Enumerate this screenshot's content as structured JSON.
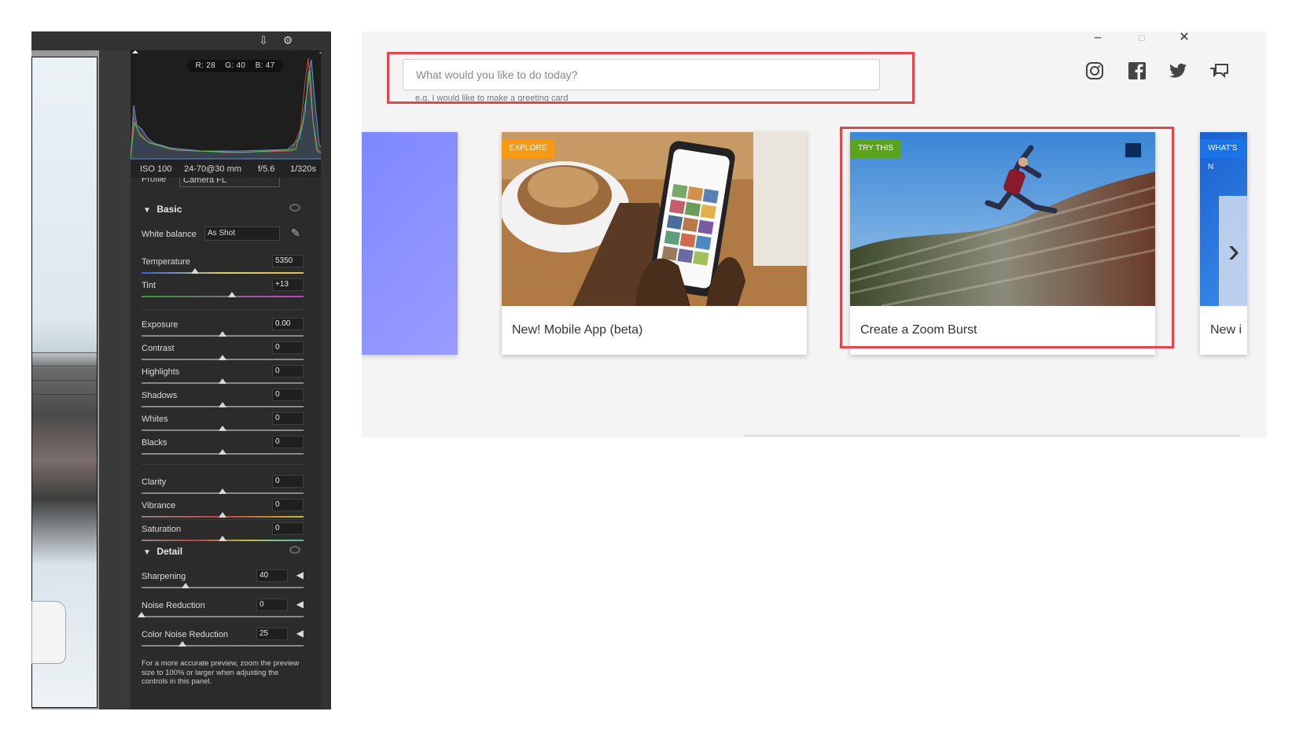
{
  "raw": {
    "histogram": {
      "r": "R: 28",
      "g": "G: 40",
      "b": "B: 47"
    },
    "meta": {
      "iso": "ISO 100",
      "lens": "24-70@30 mm",
      "aperture": "f/5.6",
      "shutter": "1/320s"
    },
    "profile": {
      "label": "Profile",
      "value": "Camera FL"
    },
    "basic": {
      "title": "Basic",
      "white_balance_label": "White balance",
      "white_balance_value": "As Shot",
      "controls": [
        {
          "label": "Temperature",
          "value": "5350"
        },
        {
          "label": "Tint",
          "value": "+13"
        },
        {
          "label": "Exposure",
          "value": "0.00"
        },
        {
          "label": "Contrast",
          "value": "0"
        },
        {
          "label": "Highlights",
          "value": "0"
        },
        {
          "label": "Shadows",
          "value": "0"
        },
        {
          "label": "Whites",
          "value": "0"
        },
        {
          "label": "Blacks",
          "value": "0"
        },
        {
          "label": "Clarity",
          "value": "0"
        },
        {
          "label": "Vibrance",
          "value": "0"
        },
        {
          "label": "Saturation",
          "value": "0"
        }
      ]
    },
    "detail": {
      "title": "Detail",
      "controls": [
        {
          "label": "Sharpening",
          "value": "40"
        },
        {
          "label": "Noise Reduction",
          "value": "0"
        },
        {
          "label": "Color Noise Reduction",
          "value": "25"
        }
      ],
      "note": "For a more accurate preview, zoom the preview size to 100% or larger when adjusting the controls in this panel."
    }
  },
  "home": {
    "search": {
      "placeholder": "What would you like to do today?",
      "hint": "e.g. I would like to make a greeting card"
    },
    "social_icons": [
      "instagram-icon",
      "facebook-icon",
      "twitter-icon",
      "feedback-icon"
    ],
    "cards": [
      {
        "badge": "EXPLORE",
        "title": "New! Mobile App (beta)",
        "badge_color": "#f59a12"
      },
      {
        "badge": "TRY THIS",
        "title": "Create a Zoom Burst",
        "badge_color": "#5aa31c"
      },
      {
        "badge": "WHAT'S N",
        "title": "New i",
        "badge_color": "#1a73e8"
      }
    ],
    "highlight_color": "#e0474c"
  }
}
